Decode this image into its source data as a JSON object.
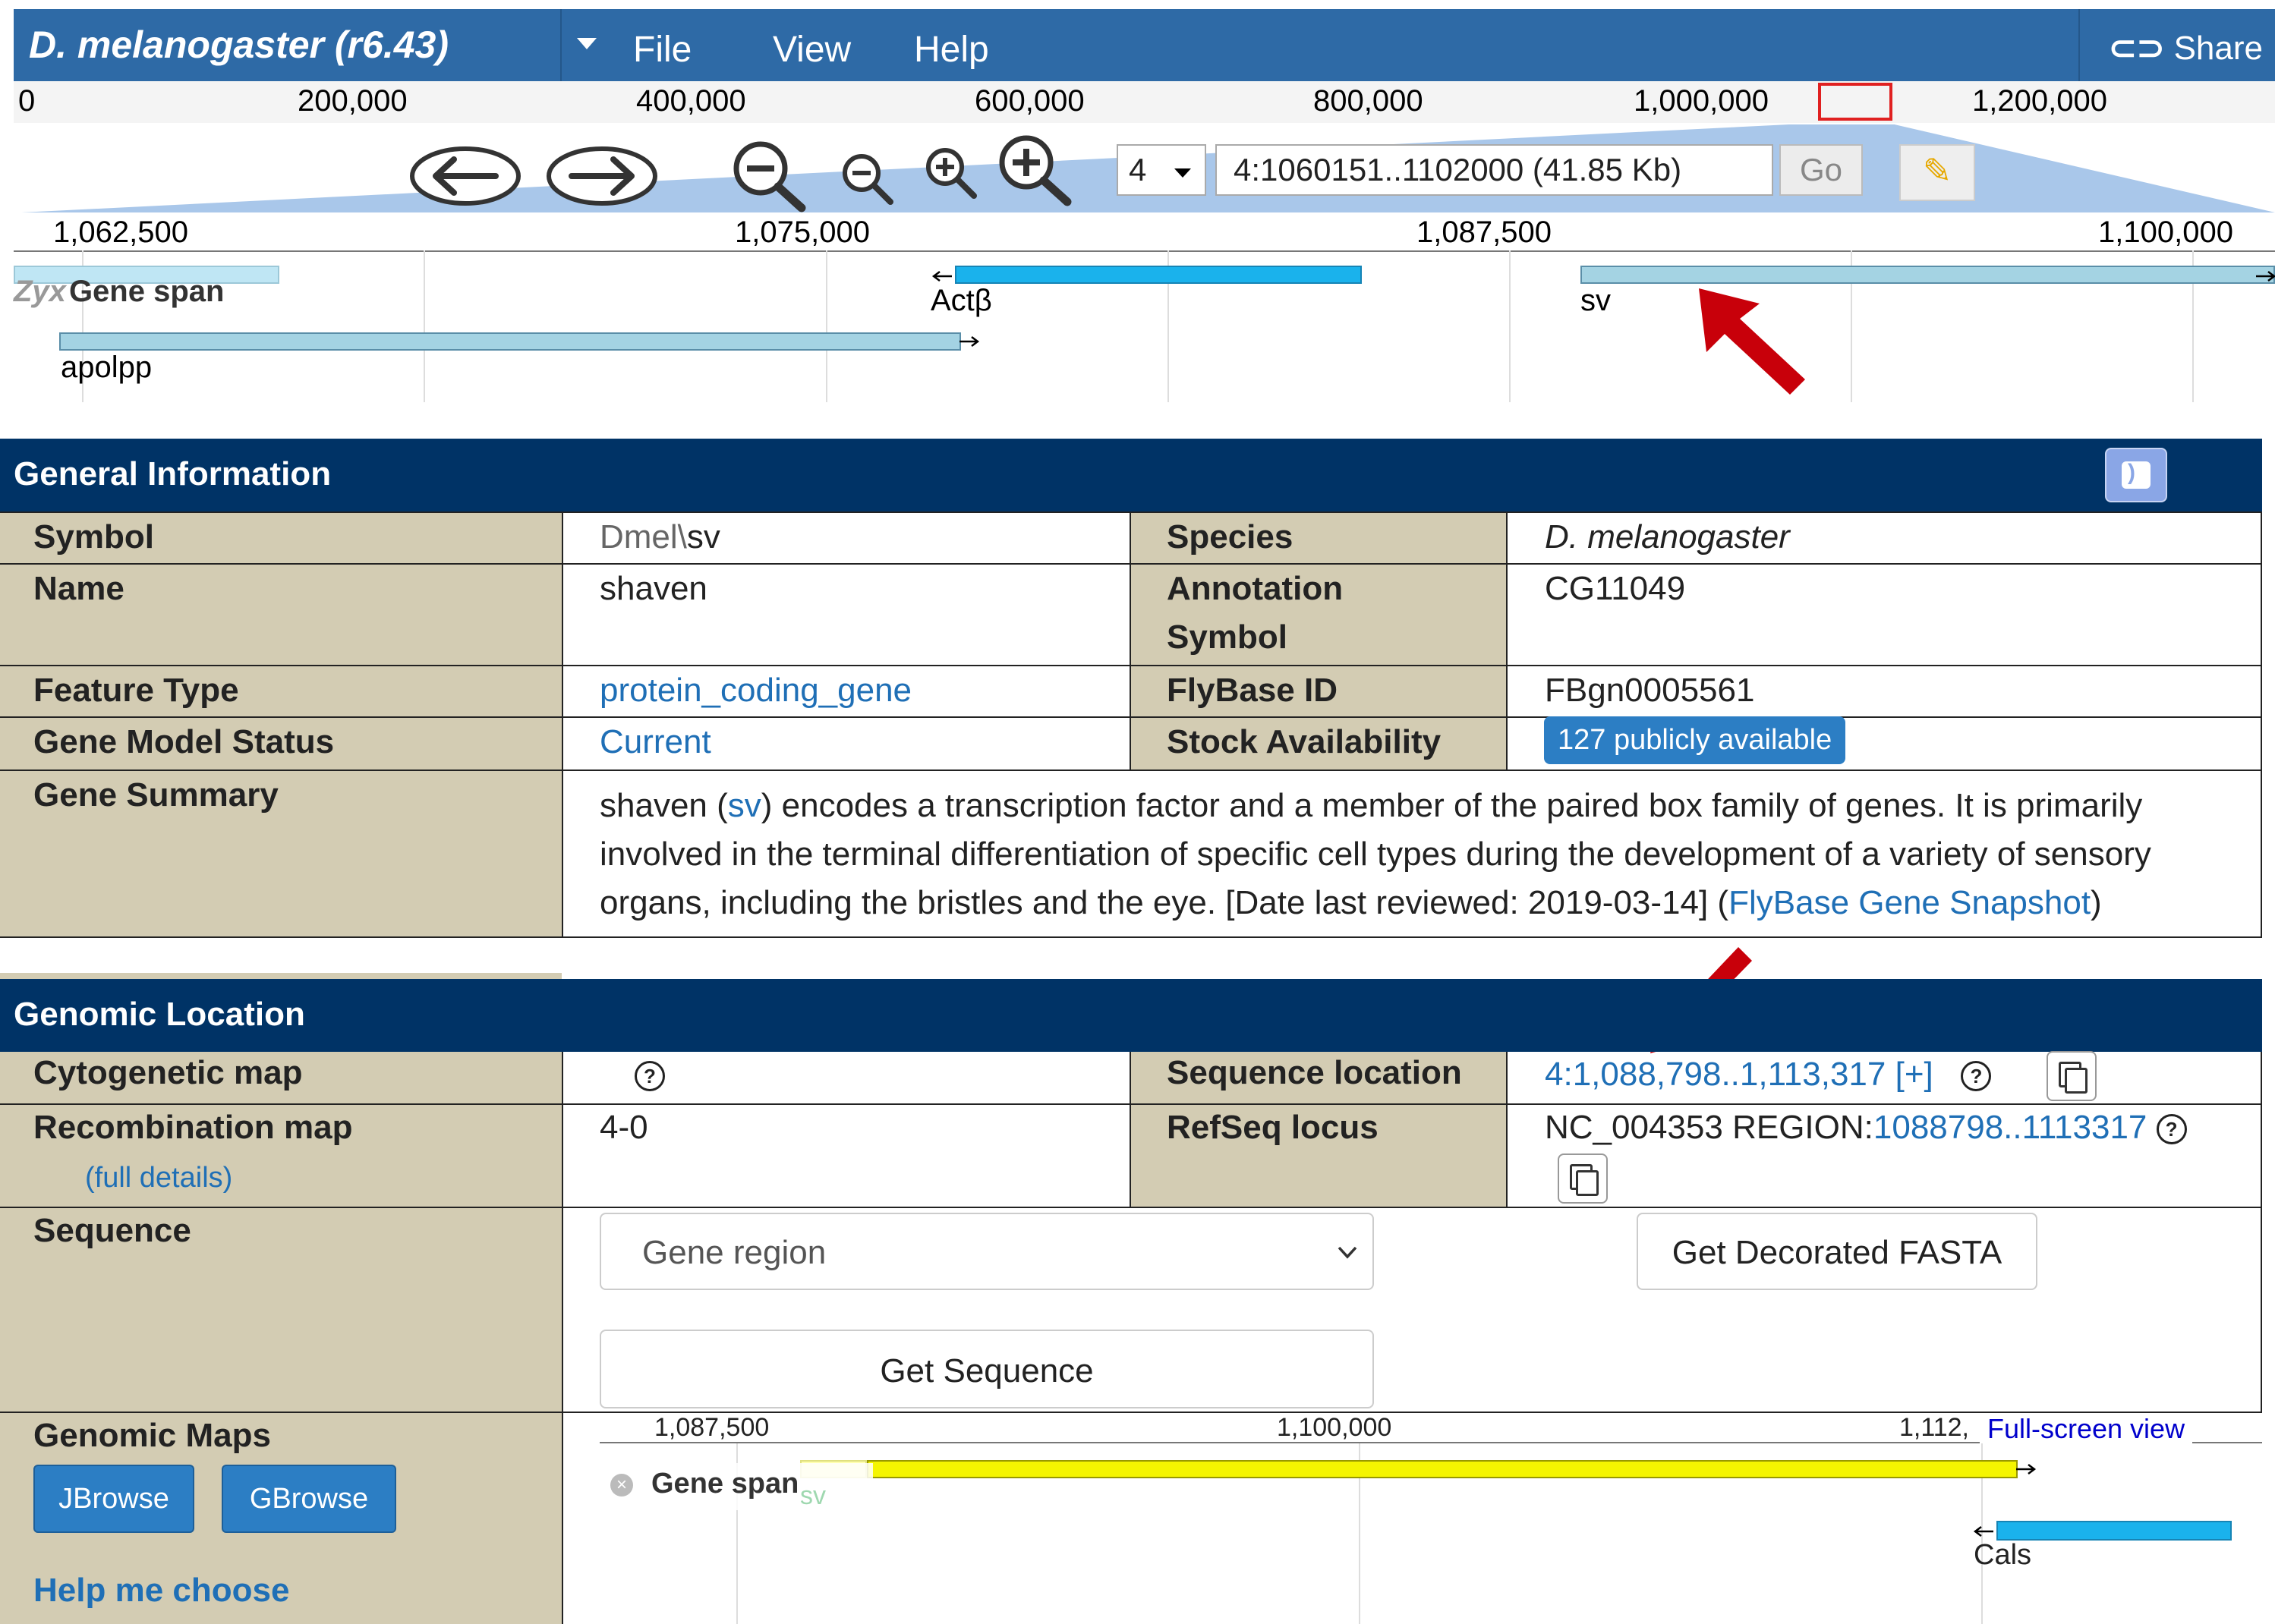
{
  "browser": {
    "title": "D. melanogaster (r6.43)",
    "menus": [
      "File",
      "View",
      "Help"
    ],
    "share_label": "Share",
    "overview_ticks": [
      "0",
      "200,000",
      "400,000",
      "600,000",
      "800,000",
      "1,000,000",
      "1,200,000"
    ],
    "ref_seq": "4",
    "location": "4:1060151..1102000 (41.85 Kb)",
    "go_label": "Go",
    "detail_ticks": [
      "1,062,500",
      "1,075,000",
      "1,087,500",
      "1,100,000"
    ],
    "track_label": "Gene span",
    "features": [
      {
        "name": "Actβ"
      },
      {
        "name": "sv"
      },
      {
        "name": "apolpp"
      }
    ],
    "colors": {
      "menubar": "#2e6aa6",
      "feature_blue": "#1ab2ec",
      "feature_light": "#a4d3e3",
      "arrow": "#c8000a"
    }
  },
  "general": {
    "header": "General Information",
    "rows": {
      "symbol_label": "Symbol",
      "symbol_prefix": "Dmel\\",
      "symbol_value": "sv",
      "species_label": "Species",
      "species_value": "D. melanogaster",
      "name_label": "Name",
      "name_value": "shaven",
      "annotation_label_1": "Annotation",
      "annotation_label_2": "Symbol",
      "annotation_value": "CG11049",
      "feature_type_label": "Feature Type",
      "feature_type_value": "protein_coding_gene",
      "flybase_id_label": "FlyBase ID",
      "flybase_id_value": "FBgn0005561",
      "gene_model_label": "Gene Model Status",
      "gene_model_value": "Current",
      "stock_label": "Stock Availability",
      "stock_value": "127 publicly available",
      "summary_label": "Gene Summary",
      "summary_start": "shaven (",
      "summary_link": "sv",
      "summary_line1_rest": ") encodes a transcription factor and a member of the paired box family of genes. It is primarily",
      "summary_line2": "involved in the terminal differentiation of specific cell types during the development of a variety of sensory",
      "summary_line3_text": "organs, including the bristles and the eye. [Date last reviewed: 2019-03-14] (",
      "summary_snapshot_link": "FlyBase Gene Snapshot",
      "summary_end": ")"
    }
  },
  "genomic": {
    "header": "Genomic Location",
    "cyto_label": "Cytogenetic map",
    "seq_loc_label": "Sequence location",
    "seq_loc_value": "4:1,088,798..1,113,317 [+]",
    "recomb_label": "Recombination map",
    "recomb_value": "4-0",
    "full_details": "(full details)",
    "refseq_label": "RefSeq locus",
    "refseq_prefix": "NC_004353 REGION:",
    "refseq_link": "1088798..1113317",
    "sequence_label": "Sequence",
    "sequence_select": "Gene region",
    "decorated_fasta": "Get Decorated FASTA",
    "get_sequence": "Get Sequence",
    "maps_label": "Genomic Maps",
    "jbrowse_btn": "JBrowse",
    "gbrowse_btn": "GBrowse",
    "help_choose": "Help me choose",
    "mini": {
      "ticks": [
        "1,087,500",
        "1,100,000",
        "1,112,"
      ],
      "fullscreen": "Full-screen view",
      "track_label": "Gene span",
      "track_sub": "sv",
      "feature_label": "Cals"
    }
  }
}
